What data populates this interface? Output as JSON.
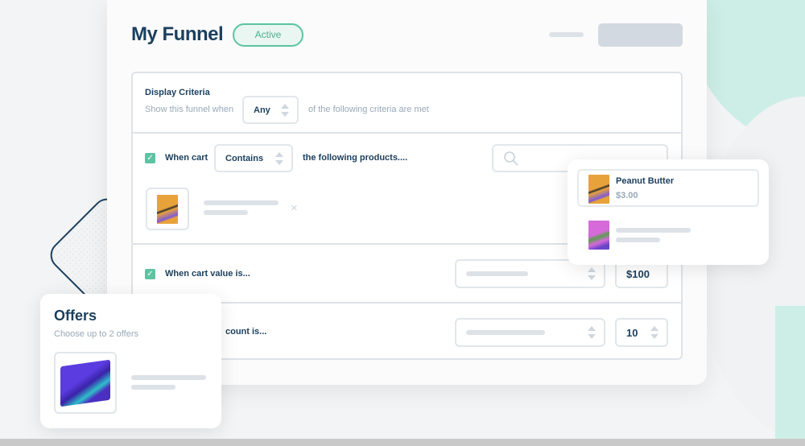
{
  "header": {
    "title": "My Funnel",
    "status": "Active"
  },
  "criteria": {
    "heading": "Display Criteria",
    "prefix": "Show this funnel when",
    "match_select": "Any",
    "suffix": "of the following criteria are met",
    "rows": [
      {
        "checked": true,
        "label": "When cart",
        "operator": "Contains",
        "trailing": "the following products...."
      },
      {
        "checked": true,
        "label": "When cart value is...",
        "value": "$100"
      },
      {
        "label": "count is...",
        "value": "10"
      }
    ]
  },
  "search_results": [
    {
      "name": "Peanut Butter",
      "price": "$3.00"
    }
  ],
  "offers": {
    "title": "Offers",
    "subtitle": "Choose up to 2 offers"
  },
  "colors": {
    "accent": "#5cc4a0",
    "navy": "#1b3f5e",
    "teal_bg": "#cdeee6"
  }
}
